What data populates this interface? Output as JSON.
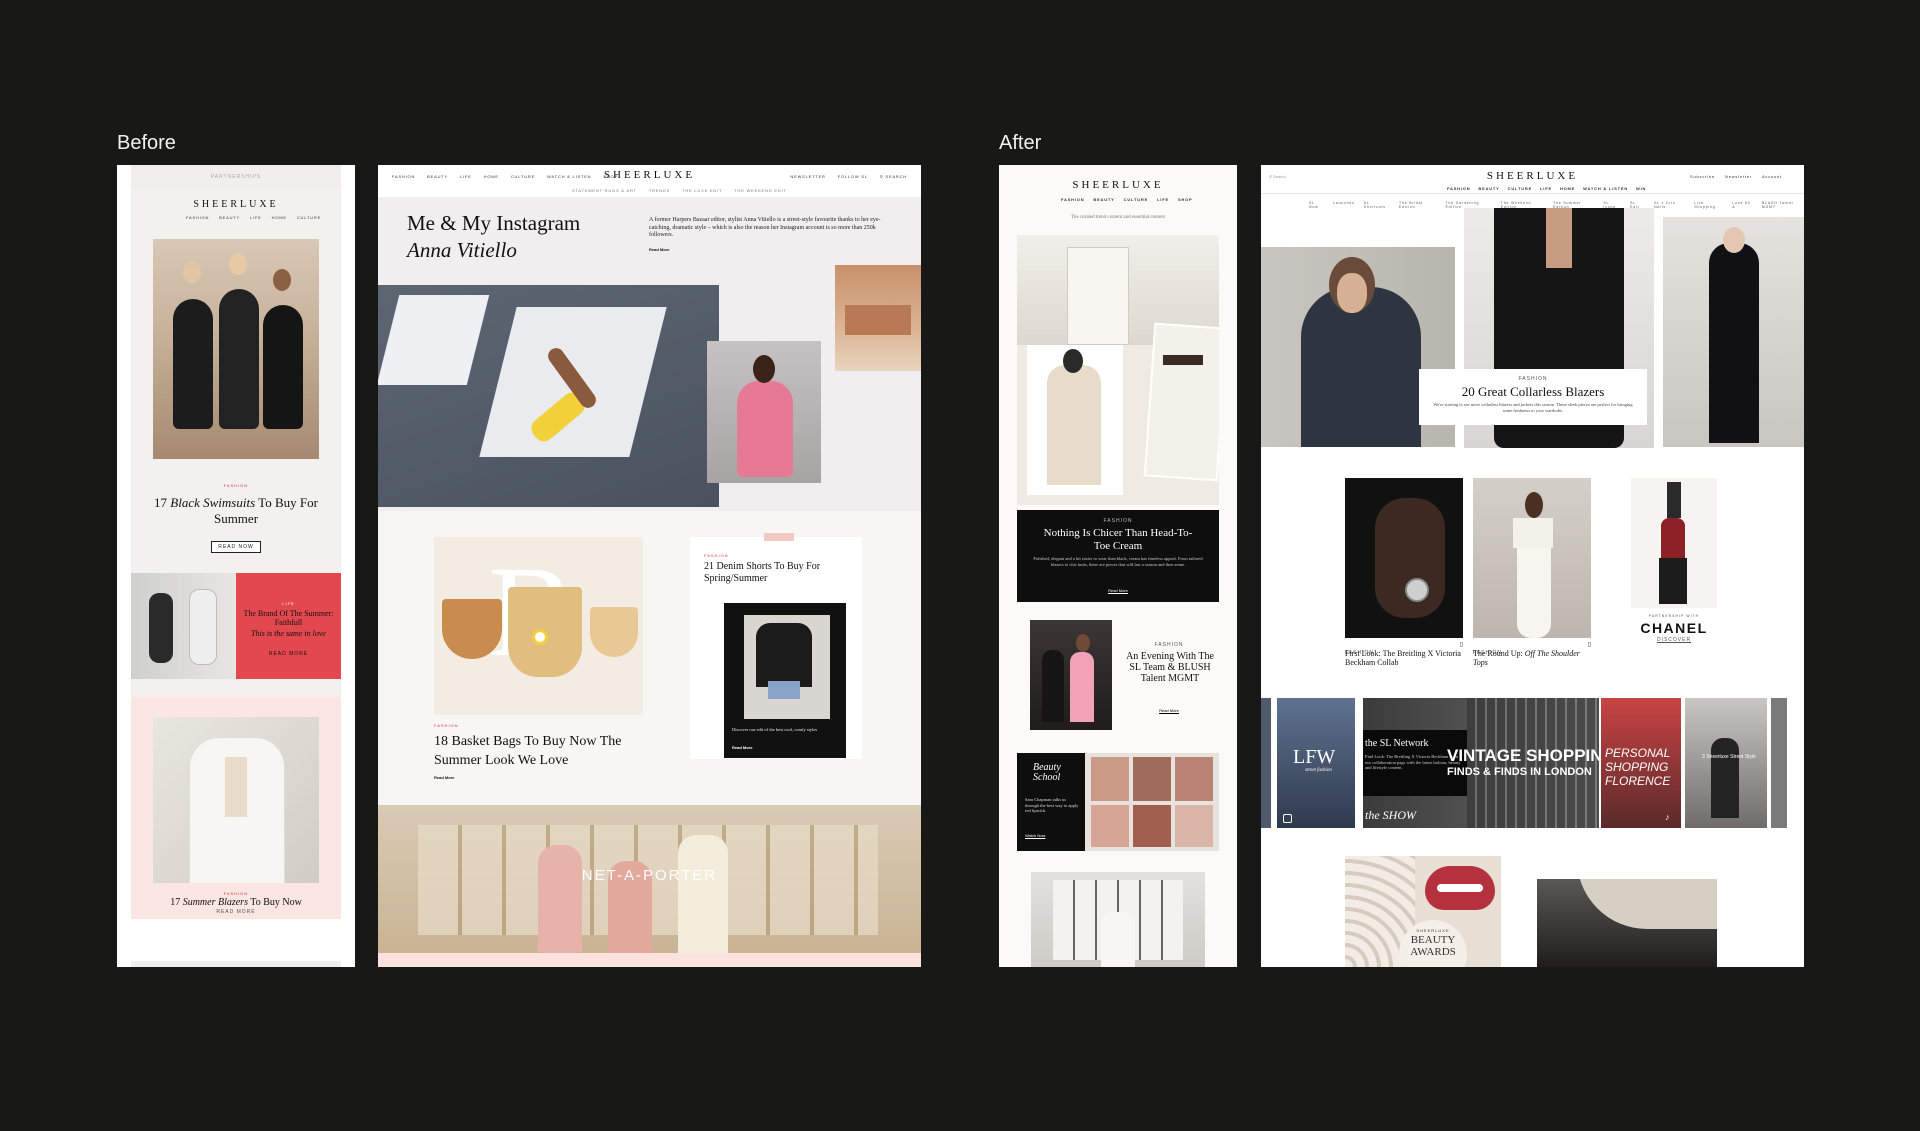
{
  "labels": {
    "before": "Before",
    "after": "After"
  },
  "brand": "SHEERLUXE",
  "before_mobile": {
    "topbar": "PARTNERSHIPS",
    "nav": [
      "FASHION",
      "BEAUTY",
      "LIFE",
      "HOME",
      "CULTURE"
    ],
    "hero_kicker": "FASHION",
    "hero_title_1": "17 ",
    "hero_title_em": "Black Swimsuits",
    "hero_title_2": " To Buy For Summer",
    "read_more": "READ NOW",
    "promo_kicker": "LIFE",
    "promo_title": "The Brand Of The Summer: Faithfull",
    "promo_sub": "This is the same in love",
    "promo_link": "READ MORE",
    "card3_kicker": "FASHION",
    "card3_title_1": "17 ",
    "card3_title_em": "Summer Blazers",
    "card3_title_2": " To Buy Now",
    "card3_link": "READ MORE"
  },
  "before_desktop": {
    "nav_left": [
      "FASHION",
      "BEAUTY",
      "LIFE",
      "HOME",
      "CULTURE",
      "WATCH & LISTEN",
      "SHOP"
    ],
    "nav_right": [
      "NEWSLETTER",
      "FOLLOW SL",
      "SEARCH"
    ],
    "subnav": [
      "STATEMENT RUGS & ART",
      "TRENDS",
      "THE LUXE EDIT",
      "THE WEEKEND EDIT"
    ],
    "hero_title": "Me & My Instagram",
    "hero_name": "Anna Vitiello",
    "hero_desc": "A former Harpers Bazaar editor, stylist Anna Vitiello is a street-style favourite thanks to her eye-catching, dramatic style – which is also the reason her Instagram account is so more than 250k followers.",
    "hero_link": "Read More",
    "card1_kicker": "FASHION",
    "card1_title": "18 Basket Bags To Buy Now The Summer Look We Love",
    "card1_link": "Read More",
    "card2_kicker": "FASHION",
    "card2_title": "21 Denim Shorts To Buy For Spring/Summer",
    "card2_caption": "Discover our edit of the best cool, comfy styles",
    "card2_link": "Read More",
    "ad_brand": "NET-A-PORTER"
  },
  "after_mobile": {
    "nav": [
      "FASHION",
      "BEAUTY",
      "CULTURE",
      "LIFE",
      "SHOP"
    ],
    "tagline": "The curated trend content and essential content",
    "feature_kicker": "FASHION",
    "feature_title": "Nothing Is Chicer Than Head-To-Toe Cream",
    "feature_desc": "Polished, elegant and a bit easier to wear than black, cream has timeless appeal. From tailored blazers to chic knits, these are pieces that will last a season and then some.",
    "feature_link": "Read More",
    "event_kicker": "FASHION",
    "event_title": "An Evening With The SL Team & BLUSH Talent MGMT",
    "event_link": "Read More",
    "beauty_title": "Beauty School",
    "beauty_desc": "Sam Chapman talks us through the best way to apply red lipstick.",
    "beauty_link": "Watch Now"
  },
  "after_desktop": {
    "search": "Search",
    "nav": [
      "FASHION",
      "BEAUTY",
      "CULTURE",
      "LIFE",
      "HOME",
      "WATCH & LISTEN",
      "WIN"
    ],
    "top_right": [
      "Subscribe",
      "Newsletter",
      "Account"
    ],
    "subnav": [
      "SL Now",
      "Launches",
      "SL Shortcuts",
      "The Bridal Edition",
      "The Gardening Edition",
      "The Weekend Edition",
      "The Summer Edition",
      "SL Icons",
      "SL Edit",
      "SL x Ciro Nails",
      "Live Shopping",
      "Luxe 50 &",
      "BLUSH Talent MGMT"
    ],
    "hero_kicker": "FASHION",
    "hero_title": "20 Great Collarless Blazers",
    "hero_desc": "We're starting to see more collarless blazers and jackets this season. These sleek pieces are perfect for bringing some freshness to your wardrobe.",
    "card1_kicker": "FASHION",
    "card1_title": "First Look: The Breitling X Victoria Beckham Collab",
    "card2_kicker": "FASHION",
    "card2_title_1": "The Round Up: ",
    "card2_title_em": "Off The Shoulder Tops",
    "chanel_kicker": "PARTNERSHIP WITH",
    "chanel_brand": "CHANEL",
    "chanel_link": "DISCOVER",
    "network_title": "the SL Network",
    "network_desc": "Find Look: The Breitling X Victoria Beckham from our collaboration page with the latest fashion, beauty and lifestyle content.",
    "lfw": "LFW",
    "lfw_sub": "street fashion",
    "show": "the SHOW",
    "vintage_1": "VINTAGE SHOPPING",
    "vintage_2": "FINDS & FINDS IN LONDON",
    "personal_1": "PERSONAL",
    "personal_2": "SHOPPING",
    "personal_3": "FLORENCE",
    "sheerluxe_style": "3 Sheerluxe Street Style",
    "beauty_badge_brand": "SHEERLUXE",
    "beauty_badge_1": "BEAUTY",
    "beauty_badge_2": "AWARDS"
  }
}
